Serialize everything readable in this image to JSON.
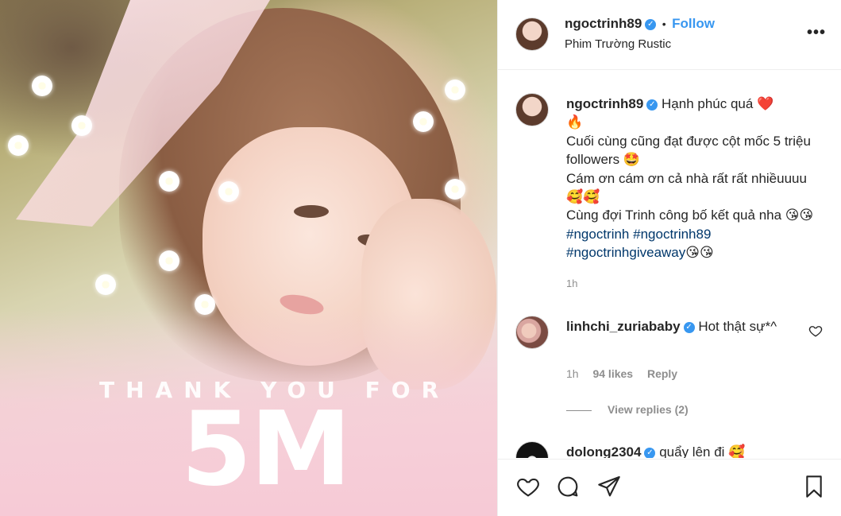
{
  "post_image": {
    "overlay_line1": "THANK YOU FOR",
    "overlay_line2": "5M"
  },
  "header": {
    "username": "ngoctrinh89",
    "verified_icon": "verified-badge-icon",
    "separator": "•",
    "follow_label": "Follow",
    "location": "Phim Trường Rustic",
    "more_label": "•••"
  },
  "caption": {
    "username": "ngoctrinh89",
    "line1": "Hạnh phúc quá ❤️",
    "line2": "🔥",
    "line3": "Cuối cùng cũng đạt được cột mốc 5 triệu followers 🤩",
    "line4": "Cám ơn cám ơn cả nhà rất rất nhiềuuuu 🥰🥰",
    "line5": "Cùng đợi Trinh công bố kết quả nha 😘😘 ",
    "hashtag1": "#ngoctrinh",
    "hashtag2": "#ngoctrinh89",
    "hashtag3": "#ngoctrinhgiveaway",
    "line6_tail": "😘😘",
    "time": "1h"
  },
  "comments": [
    {
      "username": "linhchi_zuriababy",
      "text": "Hot thật sự*^",
      "time": "1h",
      "likes": "94 likes",
      "reply_label": "Reply",
      "view_replies": "View replies (2)"
    },
    {
      "username": "dolong2304",
      "text": "quẩy lên đi 🥰"
    }
  ],
  "actions": {
    "like_icon": "heart-icon",
    "comment_icon": "comment-icon",
    "share_icon": "share-icon",
    "save_icon": "bookmark-icon"
  },
  "colors": {
    "link_blue": "#3897f0",
    "hashtag": "#00376b",
    "muted": "#8e8e8e",
    "text": "#262626"
  }
}
